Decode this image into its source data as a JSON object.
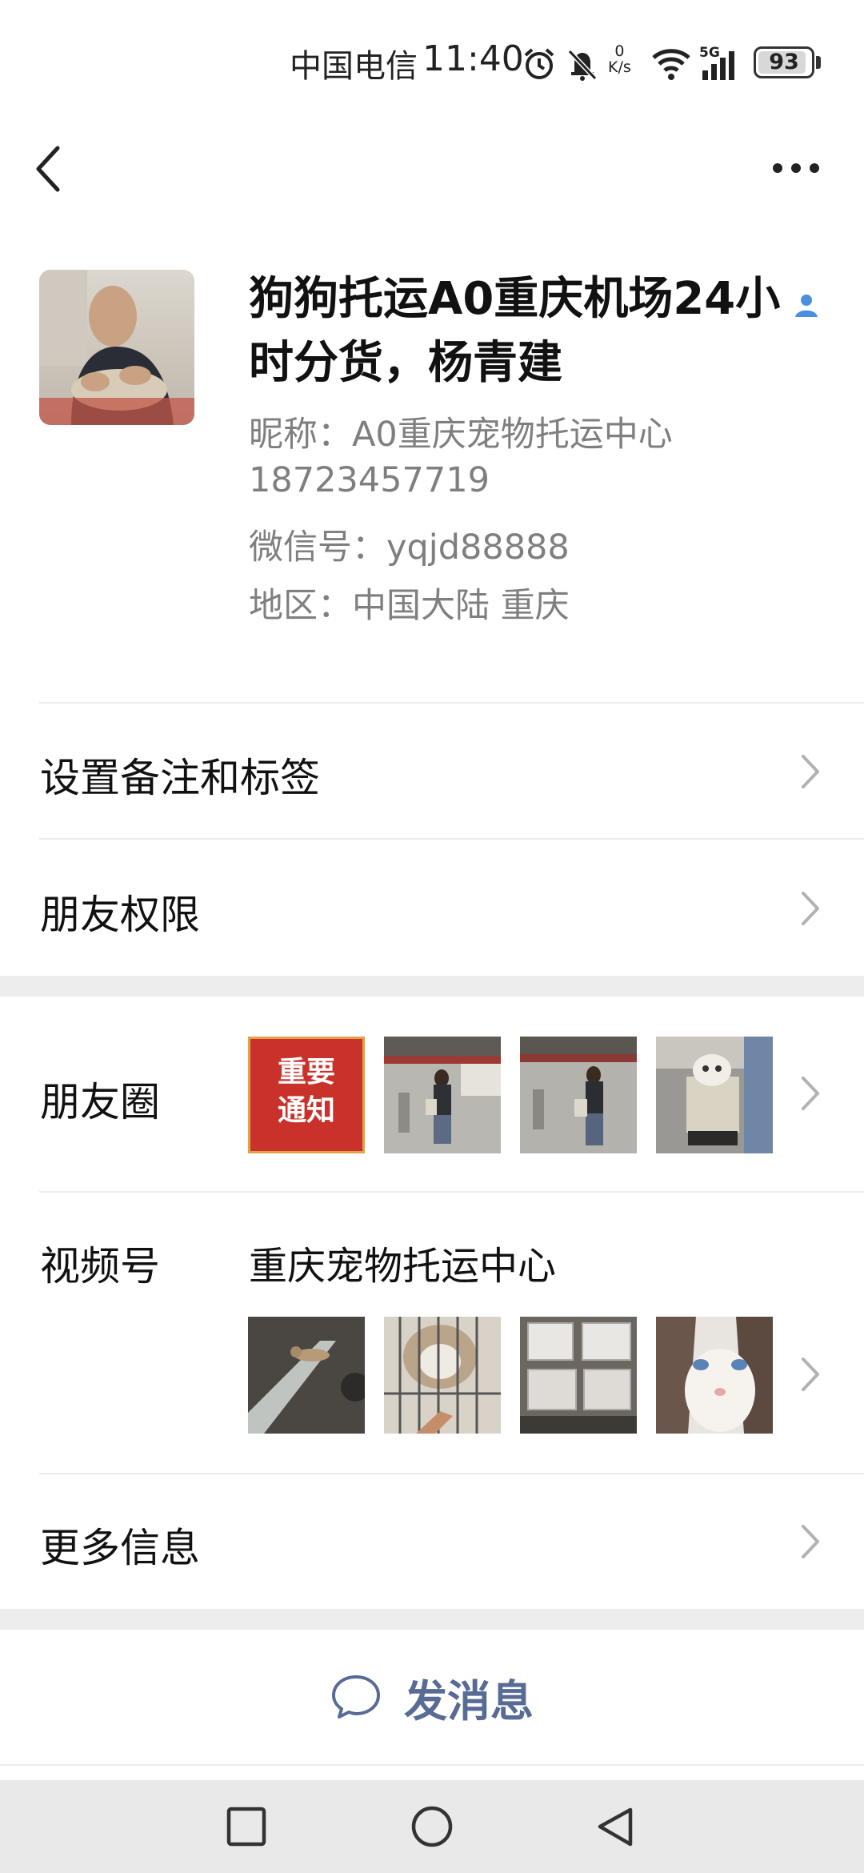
{
  "status_bar": {
    "carrier": "中国电信",
    "time": "11:40",
    "net_speed_value": "0",
    "net_speed_unit": "K/s",
    "network": "5G",
    "battery": "93",
    "battery_level": 0.93,
    "icons": [
      "alarm-icon",
      "mute-icon",
      "wifi-icon",
      "signal-icon",
      "battery-icon"
    ]
  },
  "nav": {
    "back_icon": "back-icon",
    "more_icon": "more-icon"
  },
  "profile": {
    "name": "狗狗托运A0重庆机场24小时分货，杨青建",
    "nickname": "昵称：A0重庆宠物托运中心",
    "phone": "18723457719",
    "wechat_id": "微信号：yqjd88888",
    "region": "地区：中国大陆  重庆"
  },
  "rows": {
    "remarks": "设置备注和标签",
    "permissions": "朋友权限",
    "moments": "朋友圈",
    "moments_notice": "重要通知",
    "channels": "视频号",
    "channel_name": "重庆宠物托运中心",
    "more_info": "更多信息"
  },
  "actions": {
    "send_message": "发消息"
  },
  "colors": {
    "link": "#576b95",
    "notice_red": "#c8322b",
    "verified": "#4a8fe0"
  }
}
